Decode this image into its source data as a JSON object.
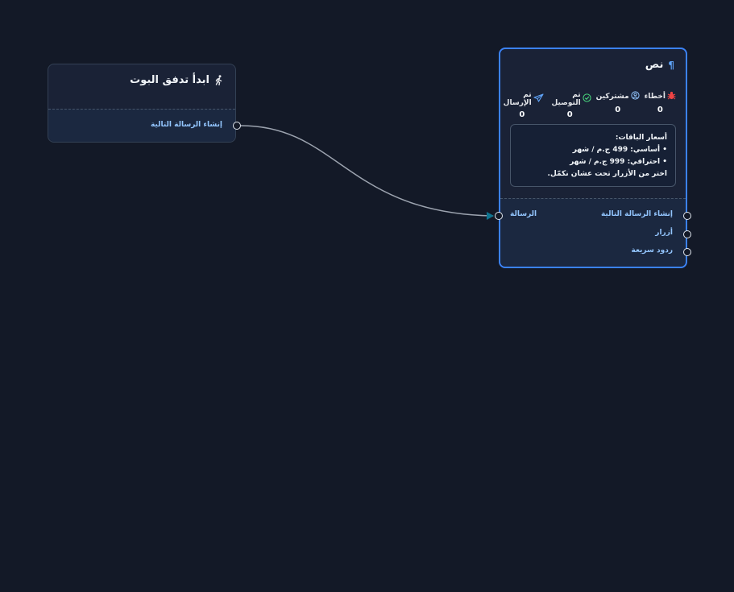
{
  "nodes": {
    "start": {
      "title": "ابدأ تدفق البوت",
      "icon": "walking-person-icon",
      "output_label": "إنشاء الرسالة التالية"
    },
    "text": {
      "title": "نص",
      "icon": "paragraph-icon",
      "stats": [
        {
          "label": "أخطاء",
          "icon": "bug-icon",
          "icon_color": "#ef4444",
          "value": "0"
        },
        {
          "label": "مشتركين",
          "icon": "user-circle-icon",
          "icon_color": "#93c5fd",
          "value": "0"
        },
        {
          "label": "تم التوصيل",
          "icon": "check-circle-icon",
          "icon_color": "#4ade80",
          "value": "0"
        },
        {
          "label": "تم الإرسال",
          "icon": "send-icon",
          "icon_color": "#60a5fa",
          "value": "0"
        }
      ],
      "message_lines": [
        "أسعار الباقات:",
        "• أساسي: 499 ج.م / شهر",
        "• احترافي: 999 ج.م / شهر",
        "اختر من الأزرار تحت عشان نكمّل."
      ],
      "input_label": "الرسالة",
      "outputs": [
        "إنشاء الرسالة التالية",
        "أزرار",
        "ردود سريعة"
      ]
    }
  },
  "colors": {
    "background": "#131927",
    "node_border": "#334155",
    "selected_border": "#3b82f6",
    "edge": "#9ca3af"
  }
}
